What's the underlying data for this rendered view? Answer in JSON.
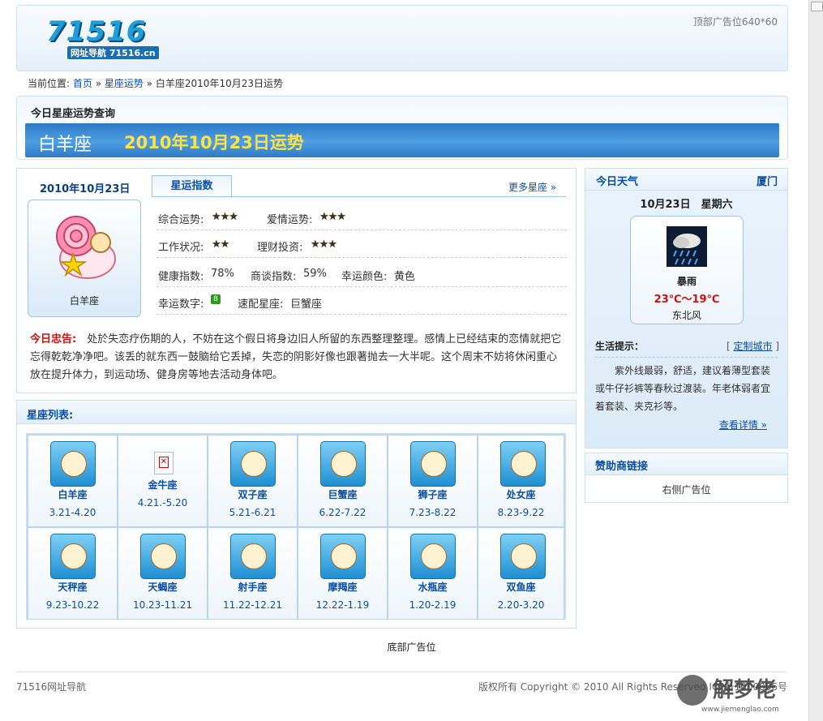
{
  "header": {
    "logo_text": "71516",
    "logo_sub": "网址导航 71516.cn",
    "top_ad": "顶部广告位640*60"
  },
  "breadcrumb": {
    "prefix": "当前位置:",
    "home": "首页",
    "sep1": "»",
    "section": "星座运势",
    "sep2": "»",
    "current": "白羊座2010年10月23日运势"
  },
  "query": {
    "title": "今日星座运势查询",
    "sign": "白羊座",
    "date_fortune": "2010年10月23日运势"
  },
  "main": {
    "date": "2010年10月23日",
    "sign_label": "白羊座",
    "tab": "星运指数",
    "more": "更多星座 »",
    "rows": {
      "overall_label": "综合运势:",
      "overall_stars": "★★★",
      "love_label": "爱情运势:",
      "love_stars": "★★★",
      "work_label": "工作状况:",
      "work_stars": "★★",
      "finance_label": "理财投资:",
      "finance_stars": "★★★",
      "health_label": "健康指数:",
      "health_value": "78%",
      "negotiate_label": "商谈指数:",
      "negotiate_value": "59%",
      "color_label": "幸运颜色:",
      "color_value": "黄色",
      "number_label": "幸运数字:",
      "number_value": "8",
      "match_label": "速配星座:",
      "match_value": "巨蟹座"
    },
    "advice_label": "今日忠告:",
    "advice_text": "处於失恋疗伤期的人，不妨在这个假日将身边旧人所留的东西整理整理。感情上已经结束的恋情就把它忘得乾乾净净吧。该丢的就东西一鼓脑给它丢掉，失恋的阴影好像也跟著抛去一大半呢。这个周末不妨将休闲重心放在提升体力，到运动场、健身房等地去活动身体吧。"
  },
  "list": {
    "title": "星座列表:",
    "signs": [
      {
        "name": "白羊座",
        "range": "3.21-4.20"
      },
      {
        "name": "金牛座",
        "range": "4.21.-5.20"
      },
      {
        "name": "双子座",
        "range": "5.21-6.21"
      },
      {
        "name": "巨蟹座",
        "range": "6.22-7.22"
      },
      {
        "name": "狮子座",
        "range": "7.23-8.22"
      },
      {
        "name": "处女座",
        "range": "8.23-9.22"
      },
      {
        "name": "天秤座",
        "range": "9.23-10.22"
      },
      {
        "name": "天蝎座",
        "range": "10.23-11.21"
      },
      {
        "name": "射手座",
        "range": "11.22-12.21"
      },
      {
        "name": "摩羯座",
        "range": "12.22-1.19"
      },
      {
        "name": "水瓶座",
        "range": "1.20-2.19"
      },
      {
        "name": "双鱼座",
        "range": "2.20-3.20"
      }
    ]
  },
  "weather": {
    "title": "今日天气",
    "city": "厦门",
    "date": "10月23日　星期六",
    "condition": "暴雨",
    "temp": "23℃～19℃",
    "wind": "东北风",
    "tip_label": "生活提示：",
    "tip_bracket_open": "[",
    "tip_link": "定制城市",
    "tip_bracket_close": "]",
    "tip_text": "紫外线最弱，舒适，建议着薄型套装或牛仔衫裤等春秋过渡装。年老体弱者宜着套装、夹克衫等。",
    "detail_link": "查看详情 »"
  },
  "sponsor": {
    "title": "赞助商链接",
    "ad": "右侧广告位"
  },
  "footer": {
    "bottom_ad": "底部广告位",
    "site_name": "71516网址导航",
    "copyright": "版权所有 Copyright © 2010 All Rights Reserved ICP备1000006号"
  },
  "watermark": {
    "text": "解梦佬",
    "url": "www.jiemenglao.com"
  },
  "colors": {
    "link": "#0b4fa0",
    "banner": "#3d8fdb",
    "banner_date": "#ffe14a",
    "warning": "#cc1111",
    "good": "#2f9a21",
    "star": "#f4b700"
  }
}
